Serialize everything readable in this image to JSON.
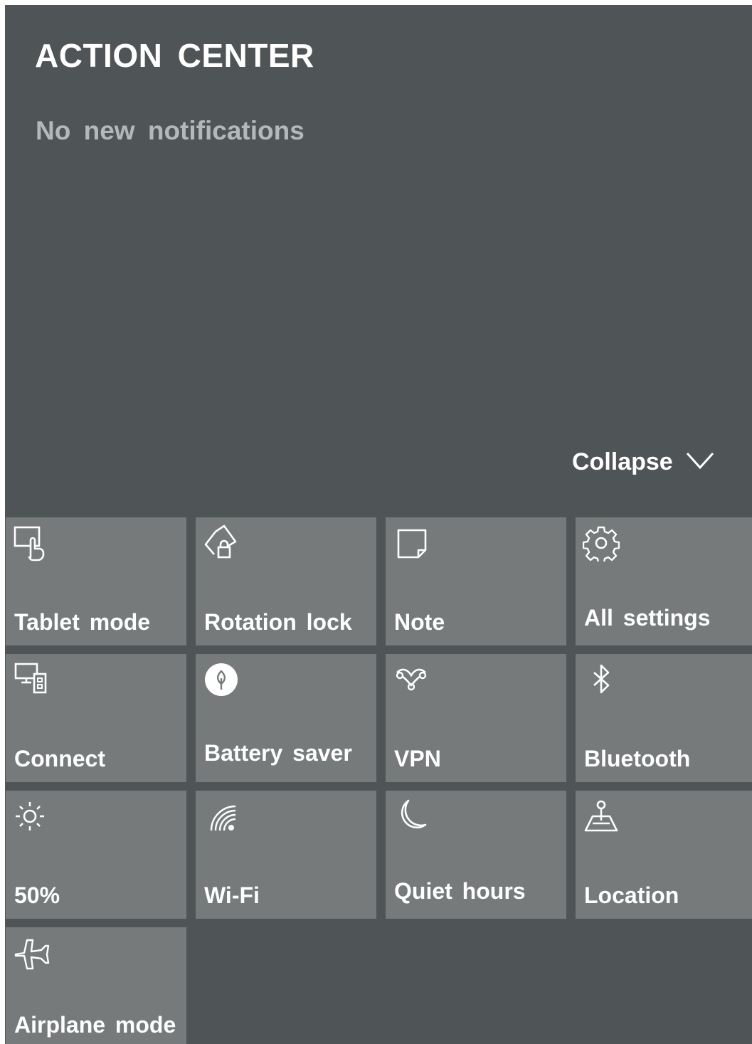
{
  "panel": {
    "title": "ACTION CENTER",
    "empty_message": "No new notifications",
    "collapse_label": "Collapse"
  },
  "quick_actions": [
    {
      "label": "Tablet mode",
      "icon": "tablet-mode-icon"
    },
    {
      "label": "Rotation lock",
      "icon": "rotation-lock-icon"
    },
    {
      "label": "Note",
      "icon": "note-icon"
    },
    {
      "label": "All settings",
      "icon": "gear-icon"
    },
    {
      "label": "Connect",
      "icon": "connect-icon"
    },
    {
      "label": "Battery saver",
      "icon": "battery-saver-icon"
    },
    {
      "label": "VPN",
      "icon": "vpn-icon"
    },
    {
      "label": "Bluetooth",
      "icon": "bluetooth-icon"
    },
    {
      "label": "50%",
      "icon": "brightness-icon"
    },
    {
      "label": "Wi-Fi",
      "icon": "wifi-icon"
    },
    {
      "label": "Quiet hours",
      "icon": "moon-icon"
    },
    {
      "label": "Location",
      "icon": "location-icon"
    },
    {
      "label": "Airplane mode",
      "icon": "airplane-icon"
    }
  ],
  "colors": {
    "panel_background": "#4f5556",
    "tile_background": "#767a7b",
    "text": "#ffffff",
    "muted_text": "#b4b8b9"
  }
}
